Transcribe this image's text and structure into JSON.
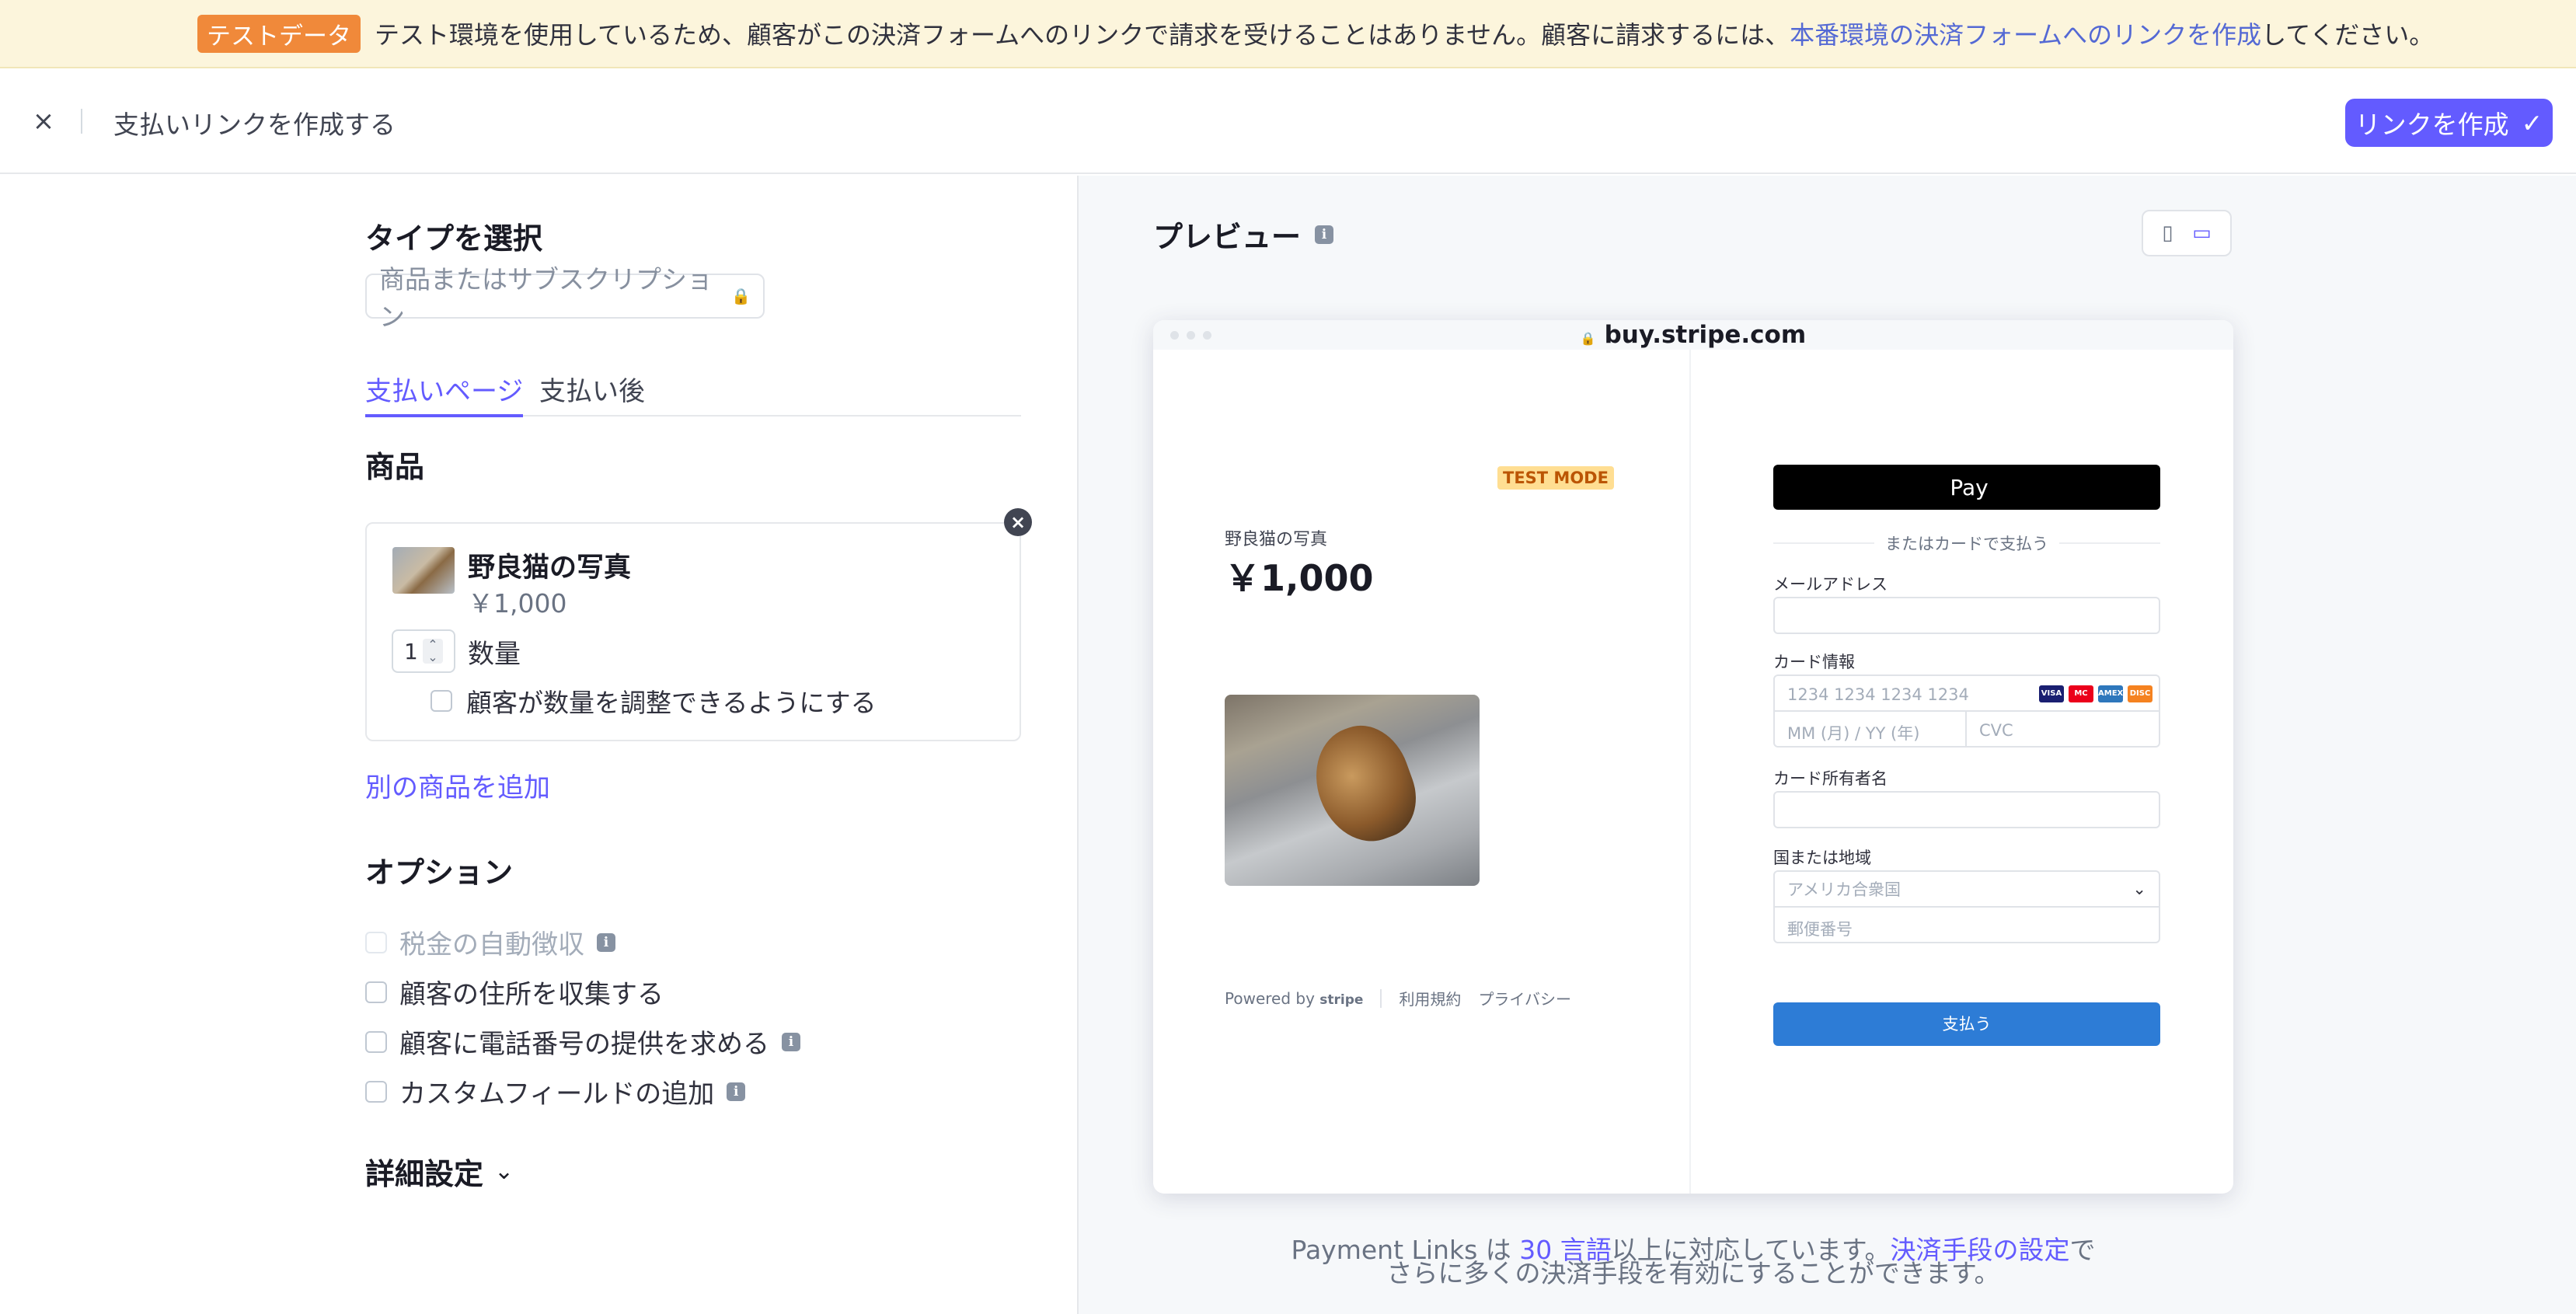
{
  "banner": {
    "badge": "テストデータ",
    "text": "テスト環境を使用しているため、顧客がこの決済フォームへのリンクで請求を受けることはありません。顧客に請求するには、",
    "link": "本番環境の決済フォームへのリンクを作成",
    "suffix": "してください。"
  },
  "header": {
    "close_icon": "×",
    "title": "支払いリンクを作成する",
    "create_button": "リンクを作成",
    "create_icon": "✓"
  },
  "left": {
    "type_heading": "タイプを選択",
    "type_value": "商品またはサブスクリプション",
    "lock_icon": "🔒",
    "tabs": [
      "支払いページ",
      "支払い後"
    ],
    "products_heading": "商品",
    "product": {
      "name": "野良猫の写真",
      "price": "￥1,000",
      "quantity": "1",
      "quantity_label": "数量",
      "adjust_label": "顧客が数量を調整できるようにする"
    },
    "remove_icon": "×",
    "add_product": "別の商品を追加",
    "options_heading": "オプション",
    "options": [
      {
        "label": "税金の自動徴収",
        "info": "i",
        "disabled": true
      },
      {
        "label": "顧客の住所を収集する"
      },
      {
        "label": "顧客に電話番号の提供を求める",
        "info": "i"
      },
      {
        "label": "カスタムフィールドの追加",
        "info": "i"
      }
    ],
    "advanced": "詳細設定",
    "advanced_icon": "⌄"
  },
  "right": {
    "preview_title": "プレビュー",
    "info_icon": "i",
    "mobile_icon": "▯",
    "desktop_icon": "▭",
    "url": "buy.stripe.com",
    "lock_icon": "🔒",
    "checkout": {
      "test_mode": "TEST MODE",
      "product_name": "野良猫の写真",
      "price": "￥1,000",
      "powered_by": "Powered by",
      "stripe": "stripe",
      "terms": "利用規約",
      "privacy": "プライバシー",
      "apple_pay": "Pay",
      "apple_icon": "",
      "or_card": "またはカードで支払う",
      "email_label": "メールアドレス",
      "card_label": "カード情報",
      "card_number_placeholder": "1234 1234 1234 1234",
      "card_brands": [
        "VISA",
        "MC",
        "AMEX",
        "DISC"
      ],
      "expiry_placeholder": "MM (月) / YY (年)",
      "cvc_placeholder": "CVC",
      "name_label": "カード所有者名",
      "country_label": "国または地域",
      "country_value": "アメリカ合衆国",
      "chevron_icon": "⌄",
      "zip_placeholder": "郵便番号",
      "pay_button": "支払う"
    },
    "note": {
      "part1": "Payment Links は ",
      "link1": "30 言語",
      "part2": "以上に対応しています。",
      "link2": "決済手段の設定",
      "part3": "で",
      "line2": "さらに多くの決済手段を有効にすることができます。"
    }
  },
  "colors": {
    "accent": "#635bff",
    "banner_bg": "#fcf5dc",
    "badge": "#f0893a",
    "pay_button": "#2d7cd6"
  }
}
